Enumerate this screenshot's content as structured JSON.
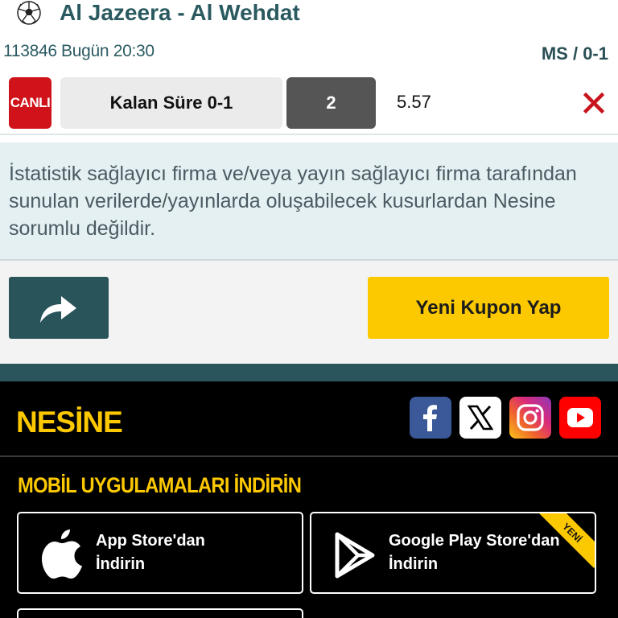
{
  "match": {
    "icon": "soccer-ball-icon",
    "title": "Al Jazeera - Al Wehdat",
    "event_code": "113846",
    "time": "Bugün 20:30",
    "market": "MS / 0-1"
  },
  "bet": {
    "live_label": "CANLI",
    "selection": "Kalan Süre 0-1",
    "pick": "2",
    "odds": "5.57",
    "remove_icon": "close-icon"
  },
  "disclaimer": {
    "text": "İstatistik sağlayıcı firma ve/veya yayın sağlayıcı firma tarafından sunulan verilerde/yayınlarda oluşabilecek kusurlardan Nesine sorumlu değildir."
  },
  "actions": {
    "share_icon": "share-arrow-icon",
    "new_coupon_label": "Yeni Kupon Yap"
  },
  "footer": {
    "brand": "NESİNE",
    "social": [
      "facebook-icon",
      "x-icon",
      "instagram-icon",
      "youtube-icon"
    ],
    "apps_heading": "MOBİL UYGULAMALARI İNDİRİN",
    "apple_line1": "App Store'dan",
    "apple_line2": "İndirin",
    "google_line1": "Google Play Store'dan",
    "google_line2": "İndirin",
    "new_badge": "YENİ"
  },
  "colors": {
    "accent_yellow": "#fcc800",
    "teal": "#28545a",
    "live_red": "#d0131a"
  }
}
